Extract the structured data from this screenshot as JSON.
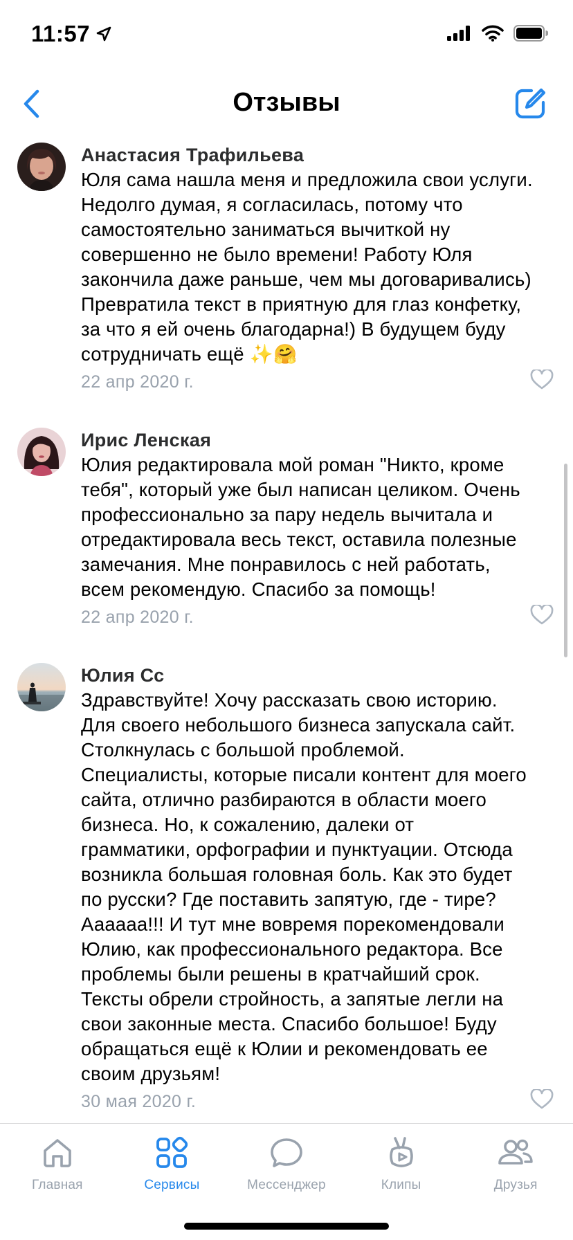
{
  "status": {
    "time": "11:57"
  },
  "nav": {
    "title": "Отзывы"
  },
  "reviews": [
    {
      "author": "Анастасия Трафильева",
      "text": "Юля сама нашла меня и предложила свои услуги.\nНедолго думая, я согласилась, потому что\nсамостоятельно заниматься вычиткой ну\nсовершенно не было времени! Работу Юля\nзакончила даже раньше, чем мы договаривались)\nПревратила текст в приятную для глаз конфетку,\nза что я ей очень благодарна!) В будущем буду\nсотрудничать ещё ✨🤗",
      "date": "22 апр 2020 г."
    },
    {
      "author": "Ирис Ленская",
      "text": "Юлия редактировала мой роман \"Никто, кроме\nтебя\", который уже был написан целиком. Очень\nпрофессионально за пару недель вычитала и\nотредактировала весь текст, оставила полезные\nзамечания. Мне понравилось с ней работать,\nвсем рекомендую. Спасибо за помощь!",
      "date": "22 апр 2020 г."
    },
    {
      "author": "Юлия Сс",
      "text": "Здравствуйте! Хочу рассказать свою историю.\nДля своего небольшого бизнеса запускала сайт.\nСтолкнулась с большой проблемой.\nСпециалисты, которые писали контент для моего\nсайта, отлично разбираются в области моего\nбизнеса. Но, к сожалению, далеки от\nграмматики, орфографии и пунктуации. Отсюда\nвозникла большая головная боль. Как это будет\nпо русски? Где поставить запятую, где - тире?\nАааааа!!! И тут мне вовремя порекомендовали\nЮлию, как профессионального редактора. Все\nпроблемы были решены в кратчайший срок.\nТексты обрели стройность, а запятые легли на\nсвои законные места. Спасибо большое! Буду\nобращаться ещё к Юлии и рекомендовать ее\nсвоим друзьям!",
      "date": "30 мая 2020 г."
    }
  ],
  "tabs": [
    {
      "label": "Главная",
      "icon": "home-icon",
      "active": false
    },
    {
      "label": "Сервисы",
      "icon": "services-icon",
      "active": true
    },
    {
      "label": "Мессенджер",
      "icon": "messenger-icon",
      "active": false
    },
    {
      "label": "Клипы",
      "icon": "clips-icon",
      "active": false
    },
    {
      "label": "Друзья",
      "icon": "friends-icon",
      "active": false
    }
  ],
  "colors": {
    "accent": "#2688eb",
    "secondary_text": "#99a2ad",
    "icon_inactive": "#99a2ad"
  }
}
